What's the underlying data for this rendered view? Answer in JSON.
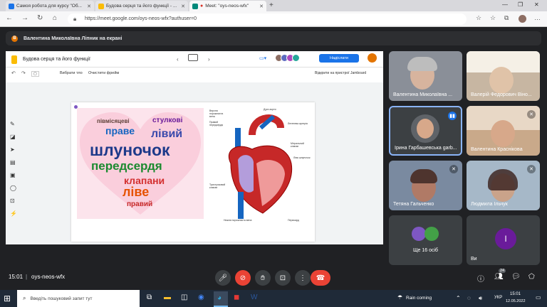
{
  "browser": {
    "tabs": [
      {
        "label": "Самоя робота для курсу \"Об...",
        "color": "#1a73e8"
      },
      {
        "label": "Будова серця та його функції - ...",
        "color": "#fbbc04"
      },
      {
        "label": "Meet: \"oys-neos-wfx\"",
        "color": "#00897b"
      }
    ],
    "url": "https://meet.google.com/oys-neos-wfx?authuser=0"
  },
  "meet": {
    "banner_avatar": "В",
    "banner": "Валентина Миколаївна Лiпник на екрані",
    "time": "15:01",
    "meeting_code": "oys-neos-wfx",
    "participants_count": "24"
  },
  "jamboard": {
    "title": "Будова серця та його функції",
    "set_background": "Вибрати тло",
    "clear_frame": "Очистити фрейм",
    "share": "Надіслати",
    "open_device": "Відкрити на пристрої Jamboard",
    "wordcloud": [
      {
        "w": "праве",
        "c": "#1565c0"
      },
      {
        "w": "лівий",
        "c": "#3949ab"
      },
      {
        "w": "шлуночок",
        "c": "#1e3a8a"
      },
      {
        "w": "передсердя",
        "c": "#1b8a2f"
      },
      {
        "w": "клапани",
        "c": "#d32f2f"
      },
      {
        "w": "ліве",
        "c": "#e65100"
      },
      {
        "w": "стулкові",
        "c": "#6a1b9a"
      },
      {
        "w": "правий",
        "c": "#c62828"
      },
      {
        "w": "півмісяцеві",
        "c": "#5d4037"
      }
    ],
    "heart_labels": [
      "Верхня порожниста вена",
      "Дуга аорти",
      "Легенева артерія",
      "Правий передсердя",
      "Мітральний клапан",
      "Ліва шлуночок",
      "Перикард",
      "Нижня порожниста вена",
      "Тристулковий клапан"
    ]
  },
  "participants": [
    {
      "name": "Валентина Миколаївна ...",
      "bg": "#8a8f98",
      "muted": false
    },
    {
      "name": "Валерій Федорович Віно...",
      "bg": "#c7b6a2",
      "muted": false
    },
    {
      "name": "Ірина Гарбашевська garb...",
      "bg": "#3c4043",
      "muted": false,
      "active": true
    },
    {
      "name": "Валентина Красніковa",
      "bg": "#c9a98a",
      "muted": true
    },
    {
      "name": "Тетяна Гальченко",
      "bg": "#7a8aa0",
      "muted": true
    },
    {
      "name": "Людмила Ільчук",
      "bg": "#a6b8c8",
      "muted": true
    },
    {
      "name": "Ще 16 осіб",
      "bg": "#3c4043"
    },
    {
      "name": "Ви",
      "bg": "#3c4043",
      "avatar": "I"
    }
  ],
  "taskbar": {
    "search_placeholder": "Введіть пошуковий запит тут",
    "weather": "Rain coming",
    "lang": "УКР",
    "time": "15:01",
    "date": "12.05.2022"
  },
  "colors": {
    "end_call": "#ea4335",
    "accent": "#1a73e8"
  }
}
